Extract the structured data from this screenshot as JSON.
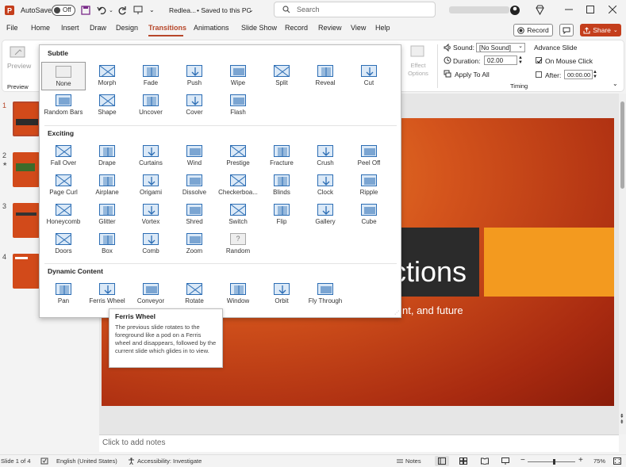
{
  "titlebar": {
    "autosave_label": "AutoSave",
    "autosave_state": "Off",
    "doc_name": "Redlea...",
    "saved_status": "• Saved to this PC",
    "search_placeholder": "Search"
  },
  "menu": {
    "tabs": [
      "File",
      "Home",
      "Insert",
      "Draw",
      "Design",
      "Transitions",
      "Animations",
      "Slide Show",
      "Record",
      "Review",
      "View",
      "Help"
    ],
    "active": "Transitions",
    "record_label": "Record",
    "share_label": "Share"
  },
  "ribbon": {
    "preview_label": "Preview",
    "preview_group": "Preview",
    "effect_options": "Effect Options",
    "sound_label": "Sound:",
    "sound_value": "[No Sound]",
    "duration_label": "Duration:",
    "duration_value": "02.00",
    "apply_all": "Apply To All",
    "timing_group": "Timing",
    "advance_label": "Advance Slide",
    "on_mouse_click": "On Mouse Click",
    "on_mouse_click_checked": true,
    "after_label": "After:",
    "after_value": "00:00.00",
    "after_checked": false
  },
  "gallery": {
    "sections": [
      {
        "title": "Subtle",
        "items": [
          "None",
          "Morph",
          "Fade",
          "Push",
          "Wipe",
          "Split",
          "Reveal",
          "Cut",
          "Random Bars",
          "Shape",
          "Uncover",
          "Cover",
          "Flash"
        ]
      },
      {
        "title": "Exciting",
        "items": [
          "Fall Over",
          "Drape",
          "Curtains",
          "Wind",
          "Prestige",
          "Fracture",
          "Crush",
          "Peel Off",
          "Page Curl",
          "Airplane",
          "Origami",
          "Dissolve",
          "Checkerboa...",
          "Blinds",
          "Clock",
          "Ripple",
          "Honeycomb",
          "Glitter",
          "Vortex",
          "Shred",
          "Switch",
          "Flip",
          "Gallery",
          "Cube",
          "Doors",
          "Box",
          "Comb",
          "Zoom",
          "Random"
        ]
      },
      {
        "title": "Dynamic Content",
        "items": [
          "Pan",
          "Ferris Wheel",
          "Conveyor",
          "Rotate",
          "Window",
          "Orbit",
          "Fly Through"
        ]
      }
    ],
    "selected": "None"
  },
  "tooltip": {
    "title": "Ferris Wheel",
    "body": "The previous slide rotates to the foreground like a pod on a Ferris wheel and disappears, followed by the current slide which glides in to view."
  },
  "slides": {
    "numbers": [
      "1",
      "2",
      "3",
      "4"
    ],
    "title_fragment": "ctions",
    "subtitle_fragment": "nt, and future"
  },
  "notes_placeholder": "Click to add notes",
  "status": {
    "slide_info": "Slide 1 of 4",
    "language": "English (United States)",
    "accessibility": "Accessibility: Investigate",
    "notes_label": "Notes",
    "zoom": "75%",
    "zoom_level": 0.55
  },
  "colors": {
    "accent": "#b7472a",
    "share": "#c43e1c",
    "icon_blue": "#2c6db4",
    "slide_orange": "#f39a1f"
  }
}
